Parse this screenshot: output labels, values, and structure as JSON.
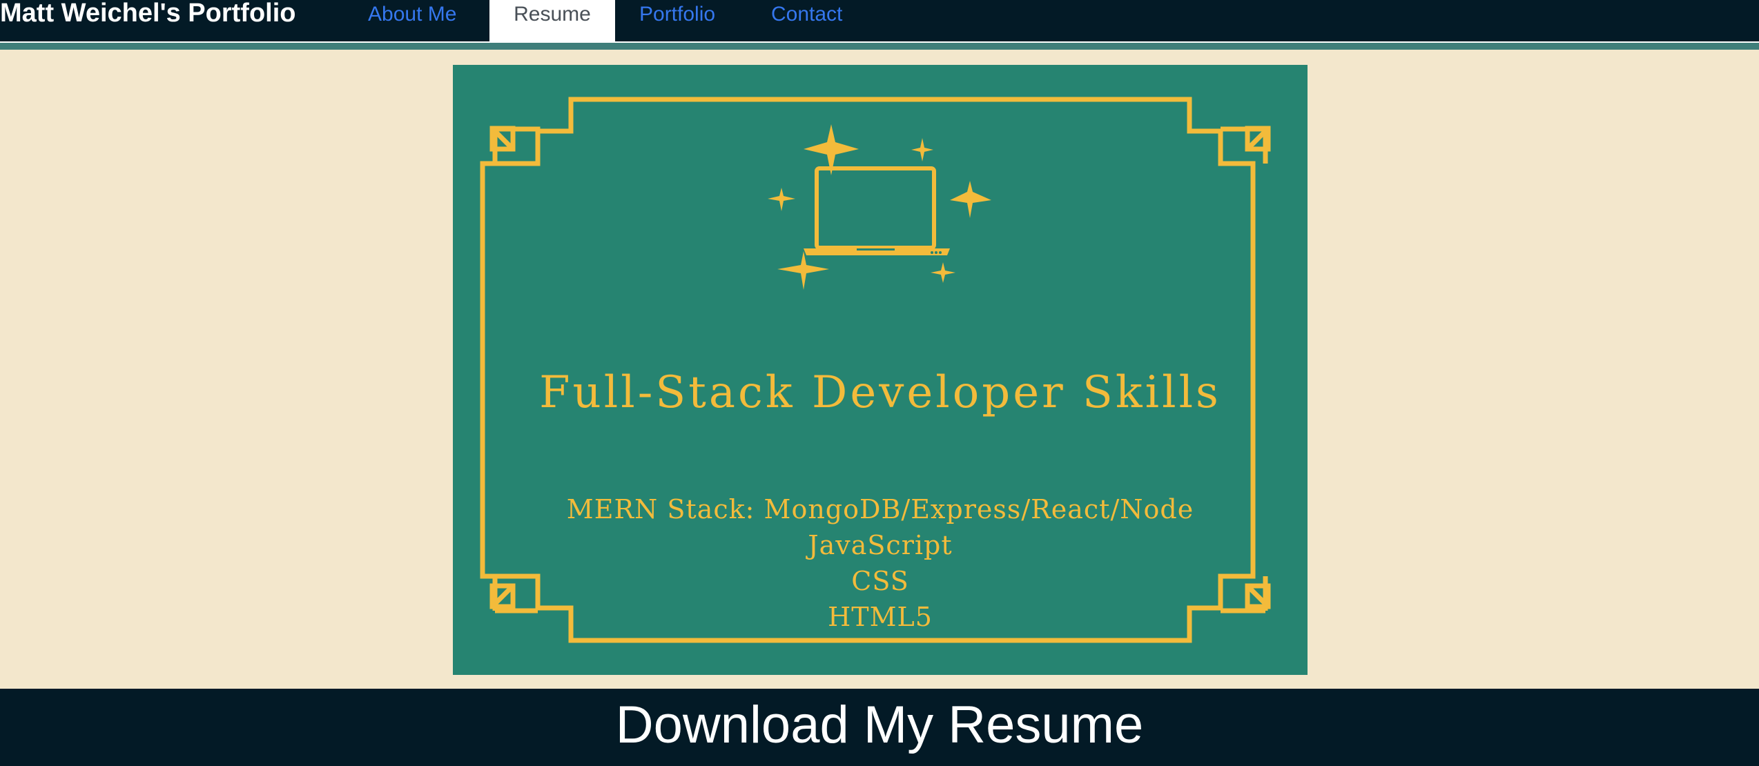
{
  "nav": {
    "brand": "Matt Weichel's Portfolio",
    "links": [
      {
        "label": "About Me",
        "active": false
      },
      {
        "label": "Resume",
        "active": true
      },
      {
        "label": "Portfolio",
        "active": false
      },
      {
        "label": "Contact",
        "active": false
      }
    ]
  },
  "card": {
    "icon": "laptop-sparkles-icon",
    "title": "Full-Stack Developer Skills",
    "skills": [
      "MERN Stack: MongoDB/Express/React/Node",
      "JavaScript",
      "CSS",
      "HTML5"
    ]
  },
  "footer": {
    "download_label": "Download My Resume"
  },
  "colors": {
    "navbar_bg": "#031a26",
    "page_bg": "#f3e7cc",
    "card_bg": "#268471",
    "gold": "#f3bb3b",
    "nav_link": "#3577ee",
    "strip": "#3f7e7a"
  }
}
